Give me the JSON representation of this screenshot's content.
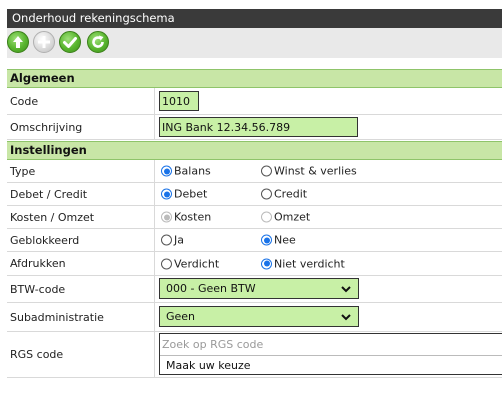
{
  "window": {
    "title": "Onderhoud rekeningschema"
  },
  "toolbar": {
    "buttons": [
      {
        "icon": "arrow-up-icon",
        "state": "enabled"
      },
      {
        "icon": "plus-icon",
        "state": "disabled"
      },
      {
        "icon": "check-icon",
        "state": "enabled"
      },
      {
        "icon": "refresh-icon",
        "state": "enabled"
      }
    ]
  },
  "sections": {
    "general": "Algemeen",
    "settings": "Instellingen"
  },
  "general": {
    "code_label": "Code",
    "code_value": "1010",
    "description_label": "Omschrijving",
    "description_value": "ING Bank 12.34.56.789"
  },
  "settings": {
    "type": {
      "label": "Type",
      "options": [
        "Balans",
        "Winst & verlies"
      ],
      "selected": "Balans"
    },
    "debit_credit": {
      "label": "Debet / Credit",
      "options": [
        "Debet",
        "Credit"
      ],
      "selected": "Debet"
    },
    "cost_revenue": {
      "label": "Kosten / Omzet",
      "options": [
        "Kosten",
        "Omzet"
      ],
      "selected": "Kosten",
      "disabled": true
    },
    "blocked": {
      "label": "Geblokkeerd",
      "options": [
        "Ja",
        "Nee"
      ],
      "selected": "Nee"
    },
    "print": {
      "label": "Afdrukken",
      "options": [
        "Verdicht",
        "Niet verdicht"
      ],
      "selected": "Niet verdicht"
    },
    "vat": {
      "label": "BTW-code",
      "value": "000 - Geen BTW"
    },
    "sub_admin": {
      "label": "Subadministratie",
      "value": "Geen"
    },
    "rgs": {
      "label": "RGS code",
      "search_placeholder": "Zoek op RGS code",
      "choice": "Maak uw keuze"
    }
  },
  "colors": {
    "titlebar": "#3a3a3a",
    "section_bg": "#c8e6a6",
    "field_bg": "#c8f0a6",
    "radio_selected": "#1a73e8",
    "button_green": "#58b52e"
  }
}
